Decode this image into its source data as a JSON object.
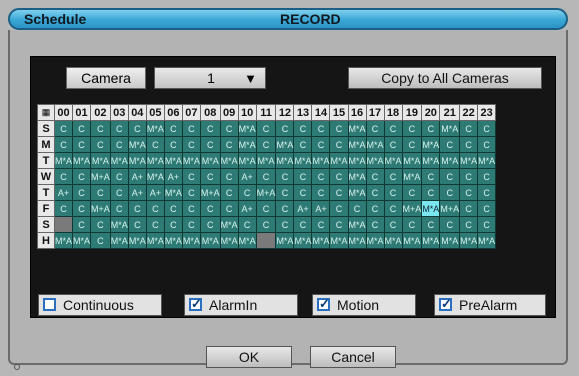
{
  "title": {
    "left": "Schedule",
    "center": "RECORD"
  },
  "camera": {
    "label": "Camera",
    "value": "1",
    "copy_label": "Copy to All Cameras"
  },
  "grid": {
    "hours": [
      "00",
      "01",
      "02",
      "03",
      "04",
      "05",
      "06",
      "07",
      "08",
      "09",
      "10",
      "11",
      "12",
      "13",
      "14",
      "15",
      "16",
      "17",
      "18",
      "19",
      "20",
      "21",
      "22",
      "23"
    ],
    "rows": [
      {
        "day": "S",
        "cells": [
          "C",
          "C",
          "C",
          "C",
          "C",
          "M*A",
          "C",
          "C",
          "C",
          "C",
          "M*A",
          "C",
          "C",
          "C",
          "C",
          "C",
          "M*A",
          "C",
          "C",
          "C",
          "C",
          "M*A",
          "C",
          "C"
        ]
      },
      {
        "day": "M",
        "cells": [
          "C",
          "C",
          "C",
          "C",
          "M*A",
          "C",
          "C",
          "C",
          "C",
          "C",
          "M*A",
          "C",
          "M*A",
          "C",
          "C",
          "C",
          "M*A",
          "M*A",
          "C",
          "C",
          "M*A",
          "C",
          "C",
          "C"
        ]
      },
      {
        "day": "T",
        "cells": [
          "M*A",
          "M*A",
          "M*A",
          "M*A",
          "M*A",
          "M*A",
          "M*A",
          "M*A",
          "M*A",
          "M*A",
          "M*A",
          "M*A",
          "M*A",
          "M*A",
          "M*A",
          "M*A",
          "M*A",
          "M*A",
          "M*A",
          "M*A",
          "M*A",
          "M*A",
          "M*A",
          "M*A"
        ]
      },
      {
        "day": "W",
        "cells": [
          "C",
          "C",
          "M+A",
          "C",
          "A+",
          "M*A",
          "A+",
          "C",
          "C",
          "C",
          "A+",
          "C",
          "C",
          "C",
          "C",
          "C",
          "M*A",
          "C",
          "C",
          "M*A",
          "C",
          "C",
          "C",
          "C"
        ]
      },
      {
        "day": "T",
        "cells": [
          "A+",
          "C",
          "C",
          "C",
          "A+",
          "A+",
          "M*A",
          "C",
          "M+A",
          "C",
          "C",
          "M+A",
          "C",
          "C",
          "C",
          "C",
          "M*A",
          "C",
          "C",
          "C",
          "C",
          "C",
          "C",
          "C"
        ]
      },
      {
        "day": "F",
        "cells": [
          "C",
          "C",
          "M+A",
          "C",
          "C",
          "C",
          "C",
          "C",
          "C",
          "C",
          "A+",
          "C",
          "C",
          "A+",
          "A+",
          "C",
          "C",
          "C",
          "C",
          "M+A",
          "M*A",
          "M+A",
          "C",
          "C"
        ]
      },
      {
        "day": "S",
        "cells": [
          "",
          "C",
          "C",
          "M*A",
          "C",
          "C",
          "C",
          "C",
          "C",
          "M*A",
          "C",
          "C",
          "C",
          "C",
          "C",
          "C",
          "M*A",
          "C",
          "C",
          "C",
          "C",
          "C",
          "C",
          "C"
        ]
      },
      {
        "day": "H",
        "cells": [
          "M*A",
          "M*A",
          "C",
          "M*A",
          "M*A",
          "M*A",
          "M*A",
          "M*A",
          "M*A",
          "M*A",
          "M*A",
          "",
          "M*A",
          "M*A",
          "M*A",
          "M*A",
          "M*A",
          "M*A",
          "M*A",
          "M*A",
          "M*A",
          "M*A",
          "M*A",
          "M*A"
        ]
      }
    ],
    "selected": {
      "row": 5,
      "col": 20
    }
  },
  "legend": [
    {
      "label": "Continuous",
      "checked": false
    },
    {
      "label": "AlarmIn",
      "checked": true
    },
    {
      "label": "Motion",
      "checked": true
    },
    {
      "label": "PreAlarm",
      "checked": true
    }
  ],
  "buttons": {
    "ok": "OK",
    "cancel": "Cancel"
  }
}
